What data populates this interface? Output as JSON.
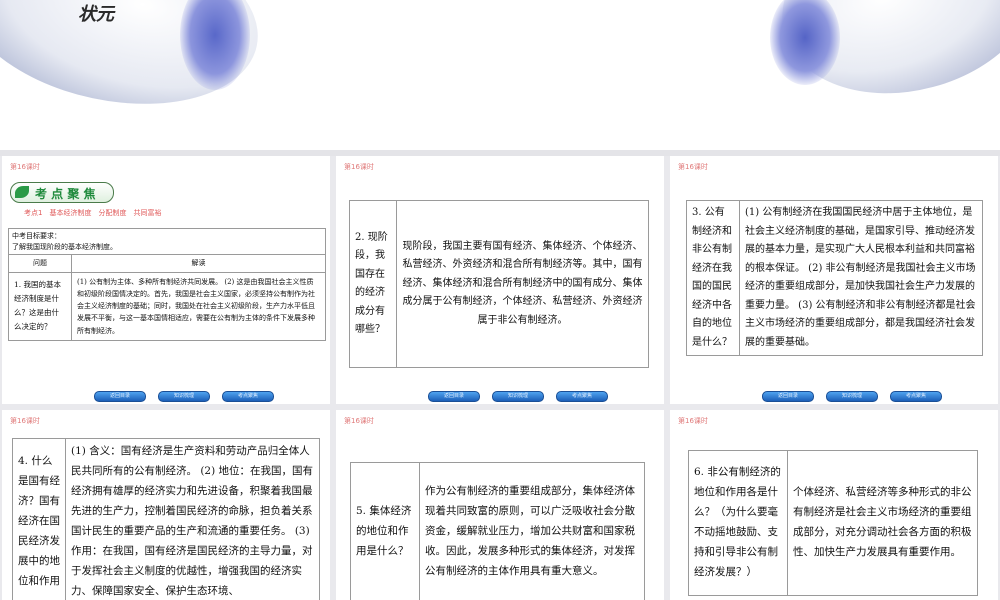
{
  "page_tag": "第16课时",
  "banner": {
    "logo_text": "状元"
  },
  "section": {
    "title": "考 点 聚 焦",
    "subtitle": "考点1　基本经济制度　分配制度　共同富裕"
  },
  "nav_buttons": [
    "返回目录",
    "知识梳理",
    "考点聚焦"
  ],
  "panel1": {
    "requirement_label": "中考目标要求：",
    "requirement_text": "了解我国现阶段的基本经济制度。",
    "col_question": "问题",
    "col_answer": "解读",
    "q1": "1. 我国的基本经济制度是什么？这是由什么决定的？",
    "a1": "(1) 公有制为主体、多种所有制经济共同发展。 (2) 这是由我国社会主义性质和初级阶段国情决定的。首先，我国是社会主义国家，必须坚持公有制作为社会主义经济制度的基础；同时，我国处在社会主义初级阶段，生产力水平低且发展不平衡，与这一基本国情相适应，需要在公有制为主体的条件下发展多种所有制经济。"
  },
  "panel2": {
    "q": "2. 现阶段，我国存在的经济成分有哪些？",
    "a": "现阶段，我国主要有国有经济、集体经济、个体经济、私营经济、外资经济和混合所有制经济等。其中，国有经济、集体经济和混合所有制经济中的国有成分、集体成分属于公有制经济，个体经济、私营经济、外资经济属于非公有制经济。"
  },
  "panel3": {
    "q": "3. 公有制经济和非公有制经济在我国的国民经济中各自的地位是什么？",
    "a": "(1) 公有制经济在我国国民经济中居于主体地位，是社会主义经济制度的基础，是国家引导、推动经济发展的基本力量，是实现广大人民根本利益和共同富裕的根本保证。 (2) 非公有制经济是我国社会主义市场经济的重要组成部分，是加快我国社会生产力发展的重要力量。 (3) 公有制经济和非公有制经济都是社会主义市场经济的重要组成部分，都是我国经济社会发展的重要基础。"
  },
  "panel4": {
    "q": "4. 什么是国有经济？国有经济在国民经济发展中的地位和作用",
    "a": "(1) 含义：国有经济是生产资料和劳动产品归全体人民共同所有的公有制经济。 (2) 地位：在我国，国有经济拥有雄厚的经济实力和先进设备，积聚着我国最先进的生产力，控制着国民经济的命脉，担负着关系国计民生的重要产品的生产和流通的重要任务。 (3) 作用：在我国，国有经济是国民经济的主导力量，对于发挥社会主义制度的优越性，增强我国的经济实力、保障国家安全、保护生态环境、"
  },
  "panel5": {
    "q": "5. 集体经济的地位和作用是什么？",
    "a": "作为公有制经济的重要组成部分，集体经济体现着共同致富的原则，可以广泛吸收社会分散资金，缓解就业压力，增加公共财富和国家税收。因此，发展多种形式的集体经济，对发挥公有制经济的主体作用具有重大意义。"
  },
  "panel6": {
    "q": "6. 非公有制经济的地位和作用各是什么？（为什么要毫不动摇地鼓励、支持和引导非公有制经济发展？）",
    "a": "个体经济、私营经济等多种形式的非公有制经济是社会主义市场经济的重要组成部分，对充分调动社会各方面的积极性、加快生产力发展具有重要作用。"
  },
  "colors": {
    "accent_blue": "#3c6fd8",
    "title_green": "#1f8a3c",
    "tag_red": "#e07b7b"
  }
}
